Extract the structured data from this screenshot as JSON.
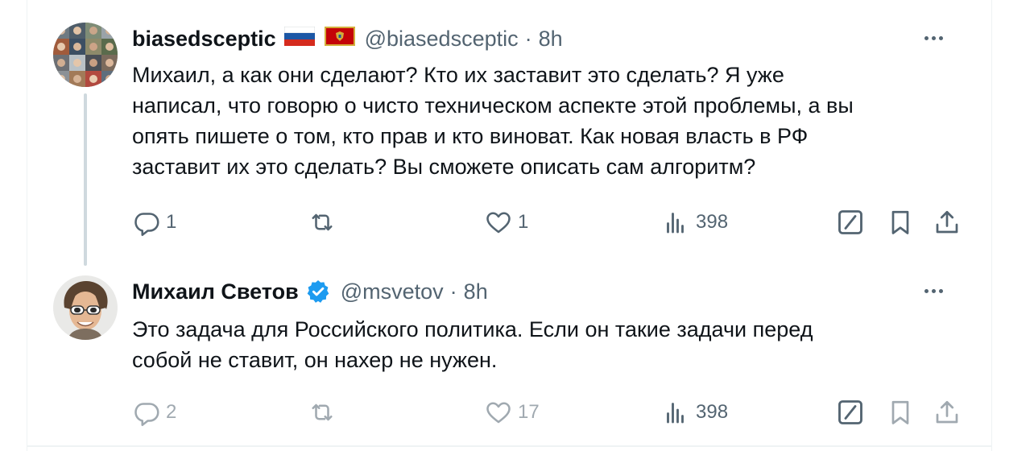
{
  "tweets": [
    {
      "display_name": "biasedsceptic",
      "flags": [
        "russian-flag-icon",
        "montenegro-flag-icon"
      ],
      "handle": "@biasedsceptic",
      "separator": "·",
      "time": "8h",
      "text_lines": [
        "Михаил, а как они сделают? Кто их заставит это сделать? Я уже",
        "написал, что говорю о чисто техническом аспекте этой проблемы, а вы",
        "опять пишете о том, кто прав и кто виноват. Как новая власть в РФ",
        "заставит их это сделать? Вы сможете описать сам алгоритм?"
      ],
      "replies": "1",
      "retweets": "",
      "likes": "1",
      "views": "398"
    },
    {
      "display_name": "Михаил Светов",
      "verified": true,
      "handle": "@msvetov",
      "separator": "·",
      "time": "8h",
      "text_lines": [
        "Это задача для Российского политика. Если он такие задачи перед",
        "собой не ставит, он нахер не нужен."
      ],
      "replies": "2",
      "retweets": "",
      "likes": "17",
      "views": "398"
    }
  ],
  "colors": {
    "text": "#0f1419",
    "secondary": "#536471",
    "verified": "#1d9bf0",
    "thread_line": "#cfd9de",
    "border": "#eff3f4"
  }
}
